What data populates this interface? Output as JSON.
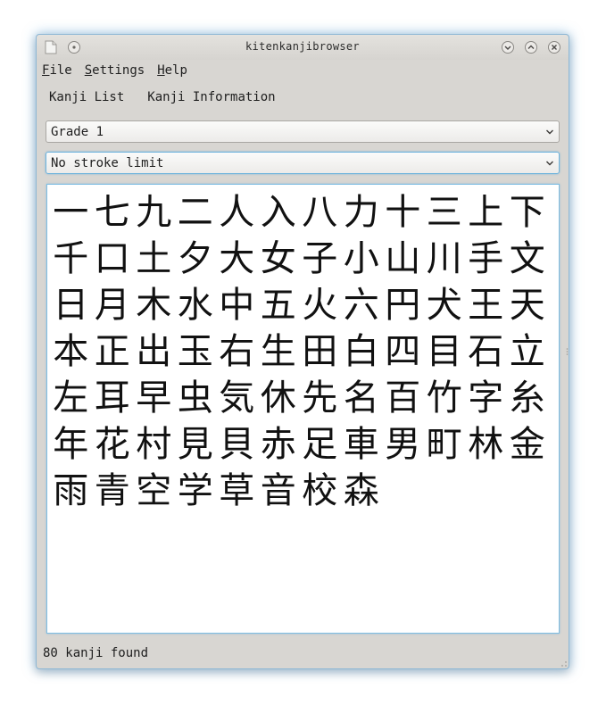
{
  "window": {
    "title": "kitenkanjibrowser"
  },
  "menubar": {
    "items": [
      {
        "accel": "F",
        "rest": "ile"
      },
      {
        "accel": "S",
        "rest": "ettings"
      },
      {
        "accel": "H",
        "rest": "elp"
      }
    ]
  },
  "tabs": [
    {
      "label": "Kanji List"
    },
    {
      "label": "Kanji Information"
    }
  ],
  "filters": {
    "grade": {
      "value": "Grade 1"
    },
    "stroke": {
      "value": "No stroke limit"
    }
  },
  "kanji": [
    "一",
    "七",
    "九",
    "二",
    "人",
    "入",
    "八",
    "力",
    "十",
    "三",
    "上",
    "下",
    "千",
    "口",
    "土",
    "夕",
    "大",
    "女",
    "子",
    "小",
    "山",
    "川",
    "手",
    "文",
    "日",
    "月",
    "木",
    "水",
    "中",
    "五",
    "火",
    "六",
    "円",
    "犬",
    "王",
    "天",
    "本",
    "正",
    "出",
    "玉",
    "右",
    "生",
    "田",
    "白",
    "四",
    "目",
    "石",
    "立",
    "左",
    "耳",
    "早",
    "虫",
    "気",
    "休",
    "先",
    "名",
    "百",
    "竹",
    "字",
    "糸",
    "年",
    "花",
    "村",
    "見",
    "貝",
    "赤",
    "足",
    "車",
    "男",
    "町",
    "林",
    "金",
    "雨",
    "青",
    "空",
    "学",
    "草",
    "音",
    "校",
    "森"
  ],
  "status": {
    "text": "80 kanji found"
  },
  "icons": {
    "app": "app-icon",
    "pin": "pin-icon",
    "minimize": "minimize-icon",
    "maximize": "maximize-icon",
    "close": "close-icon",
    "dropdown": "chevron-down-icon"
  },
  "colors": {
    "focus": "#6fb3dc",
    "window_bg": "#d8d6d2",
    "text": "#111111"
  }
}
